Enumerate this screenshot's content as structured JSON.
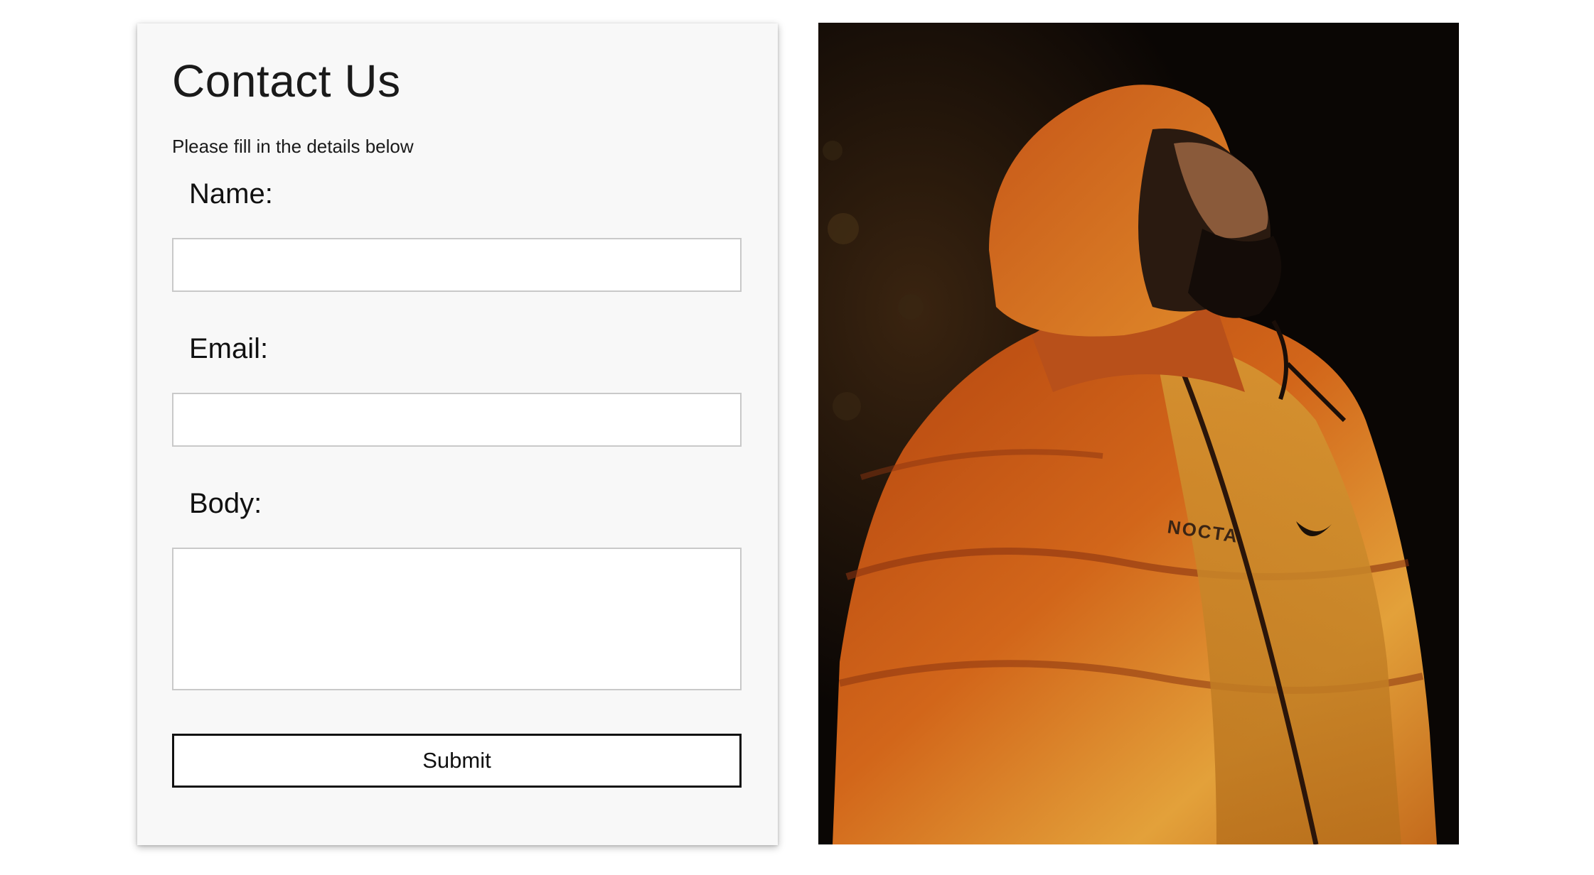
{
  "contact_form": {
    "title": "Contact Us",
    "subtitle": "Please fill in the details below",
    "fields": [
      {
        "label": "Name:",
        "value": "",
        "placeholder": ""
      },
      {
        "label": "Email:",
        "value": "",
        "placeholder": ""
      },
      {
        "label": "Body:",
        "value": "",
        "placeholder": ""
      }
    ],
    "submit_label": "Submit"
  },
  "hero_image": {
    "jacket_print": "NOCTA",
    "colors": {
      "background": "#0d0805",
      "jacket_orange": "#c85a14",
      "jacket_gold": "#e0a030"
    }
  }
}
